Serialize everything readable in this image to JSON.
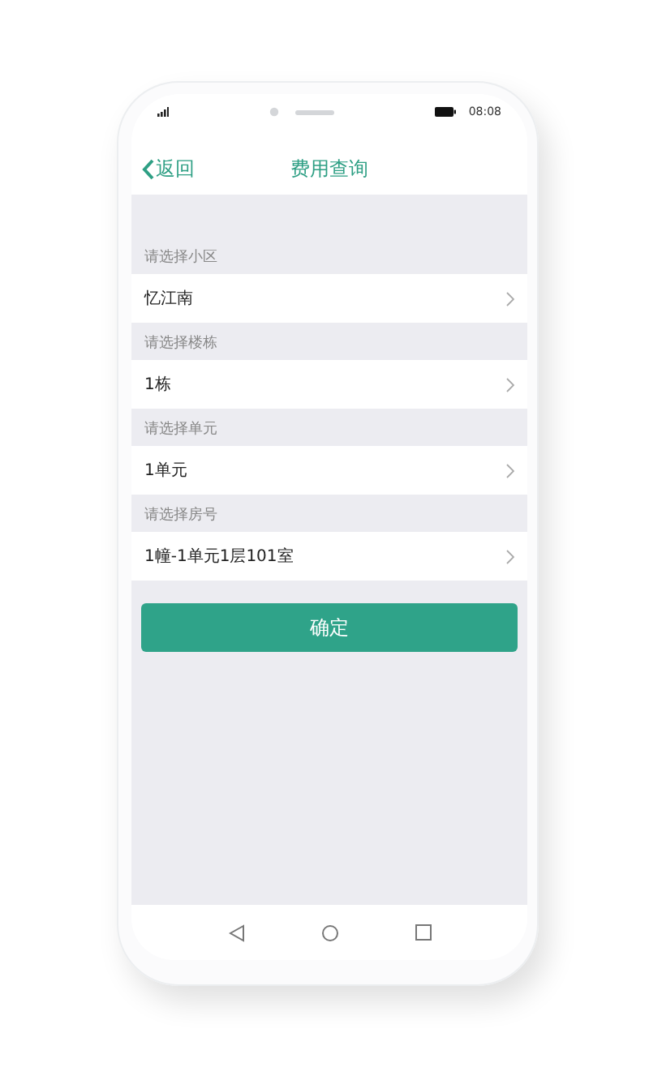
{
  "status_bar": {
    "time": "08:08"
  },
  "header": {
    "back": "返回",
    "title": "费用查询"
  },
  "fields": [
    {
      "label": "请选择小区",
      "value": "忆江南"
    },
    {
      "label": "请选择楼栋",
      "value": "1栋"
    },
    {
      "label": "请选择单元",
      "value": "1单元"
    },
    {
      "label": "请选择房号",
      "value": "1幢-1单元1层101室"
    }
  ],
  "confirm_button": "确定"
}
